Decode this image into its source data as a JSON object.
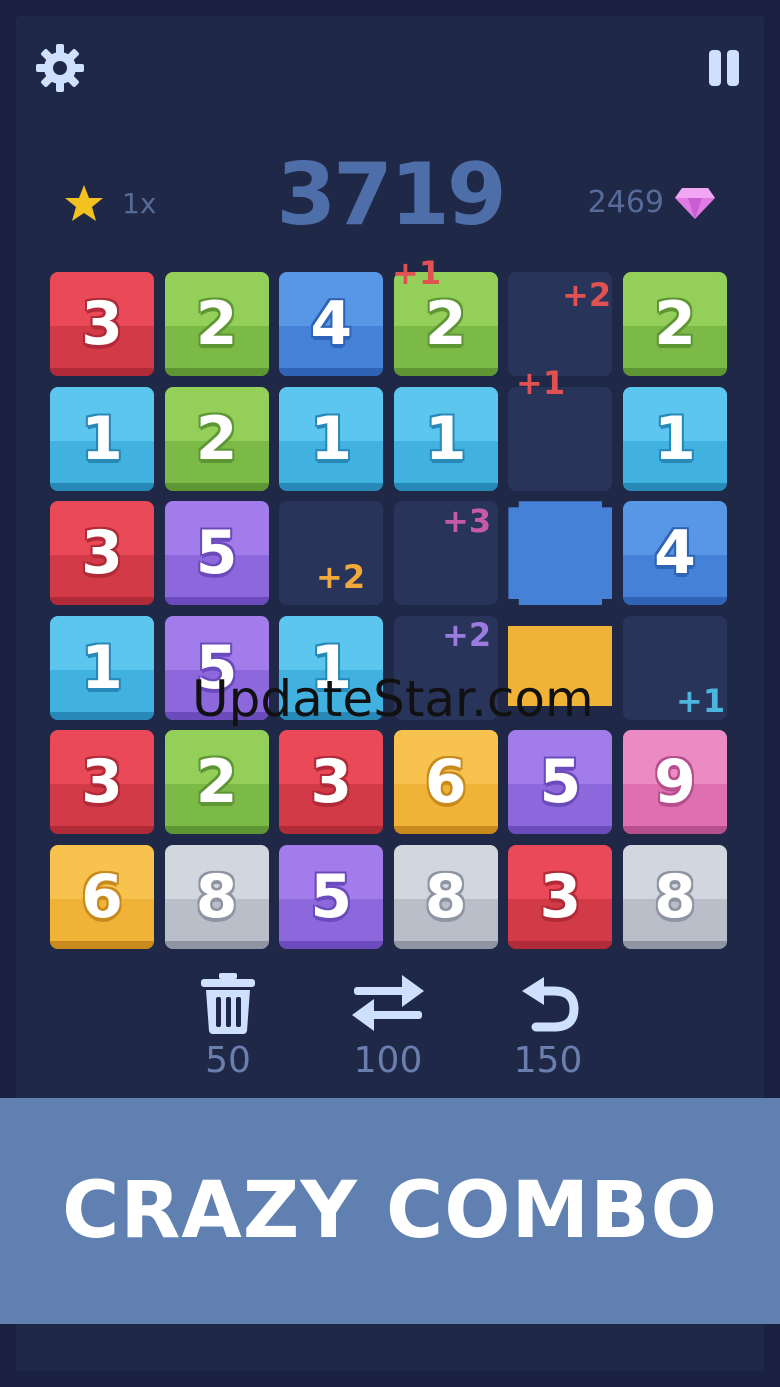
{
  "header": {
    "settings_icon": "gear-icon",
    "pause_icon": "pause-icon",
    "score": "3719",
    "multiplier": "1x",
    "gems": "2469"
  },
  "board": {
    "rows": [
      [
        {
          "v": "3",
          "c": "red"
        },
        {
          "v": "2",
          "c": "green"
        },
        {
          "v": "4",
          "c": "blue"
        },
        {
          "v": "2",
          "c": "green"
        },
        {
          "v": "",
          "c": "empty"
        },
        {
          "v": "2",
          "c": "green"
        }
      ],
      [
        {
          "v": "1",
          "c": "cyan"
        },
        {
          "v": "2",
          "c": "green"
        },
        {
          "v": "1",
          "c": "cyan"
        },
        {
          "v": "1",
          "c": "cyan"
        },
        {
          "v": "",
          "c": "empty"
        },
        {
          "v": "1",
          "c": "cyan"
        }
      ],
      [
        {
          "v": "3",
          "c": "red"
        },
        {
          "v": "5",
          "c": "purple"
        },
        {
          "v": "",
          "c": "empty"
        },
        {
          "v": "",
          "c": "empty"
        },
        {
          "v": "",
          "c": "blue-flat"
        },
        {
          "v": "4",
          "c": "blue"
        }
      ],
      [
        {
          "v": "1",
          "c": "cyan"
        },
        {
          "v": "5",
          "c": "purple"
        },
        {
          "v": "1",
          "c": "cyan"
        },
        {
          "v": "",
          "c": "empty"
        },
        {
          "v": "",
          "c": "yellow-flat"
        },
        {
          "v": "",
          "c": "empty"
        }
      ],
      [
        {
          "v": "3",
          "c": "red"
        },
        {
          "v": "2",
          "c": "green"
        },
        {
          "v": "3",
          "c": "red"
        },
        {
          "v": "6",
          "c": "yellow"
        },
        {
          "v": "5",
          "c": "purple"
        },
        {
          "v": "9",
          "c": "pink"
        }
      ],
      [
        {
          "v": "6",
          "c": "yellow"
        },
        {
          "v": "8",
          "c": "gray"
        },
        {
          "v": "5",
          "c": "purple"
        },
        {
          "v": "8",
          "c": "gray"
        },
        {
          "v": "3",
          "c": "red"
        },
        {
          "v": "8",
          "c": "gray"
        }
      ]
    ],
    "floating_labels": [
      {
        "text": "+1",
        "color": "#e05252"
      },
      {
        "text": "+2",
        "color": "#e05252"
      },
      {
        "text": "+1",
        "color": "#e05252"
      },
      {
        "text": "+3",
        "color": "#c65aa8"
      },
      {
        "text": "+2",
        "color": "#f0a93a"
      },
      {
        "text": "+2",
        "color": "#9a7be0"
      },
      {
        "text": "+1",
        "color": "#4cb5de"
      }
    ]
  },
  "watermark": "UpdateStar.com",
  "powerups": [
    {
      "icon": "trash-icon",
      "cost": "50"
    },
    {
      "icon": "swap-icon",
      "cost": "100"
    },
    {
      "icon": "undo-icon",
      "cost": "150"
    }
  ],
  "banner": {
    "text": "CRAZY COMBO"
  },
  "colors": {
    "red": [
      "#ea4a57",
      "#d33a48",
      "#b02a38"
    ],
    "green": [
      "#94cf5a",
      "#7cba48",
      "#5e9634"
    ],
    "blue": [
      "#5896e6",
      "#4581d6",
      "#2f63b5"
    ],
    "cyan": [
      "#5cc6ee",
      "#41b1e0",
      "#2789b8"
    ],
    "purple": [
      "#a27cea",
      "#8d67dc",
      "#6b4bbb"
    ],
    "yellow": [
      "#f7c34e",
      "#f0b337",
      "#c98a1d"
    ],
    "pink": [
      "#ec8ac4",
      "#de6fb0",
      "#b74f8c"
    ],
    "gray": [
      "#d2d6de",
      "#b9bec9",
      "#8e94a2"
    ],
    "accent_gold": "#f4c21f",
    "gem": "#e07be6"
  }
}
